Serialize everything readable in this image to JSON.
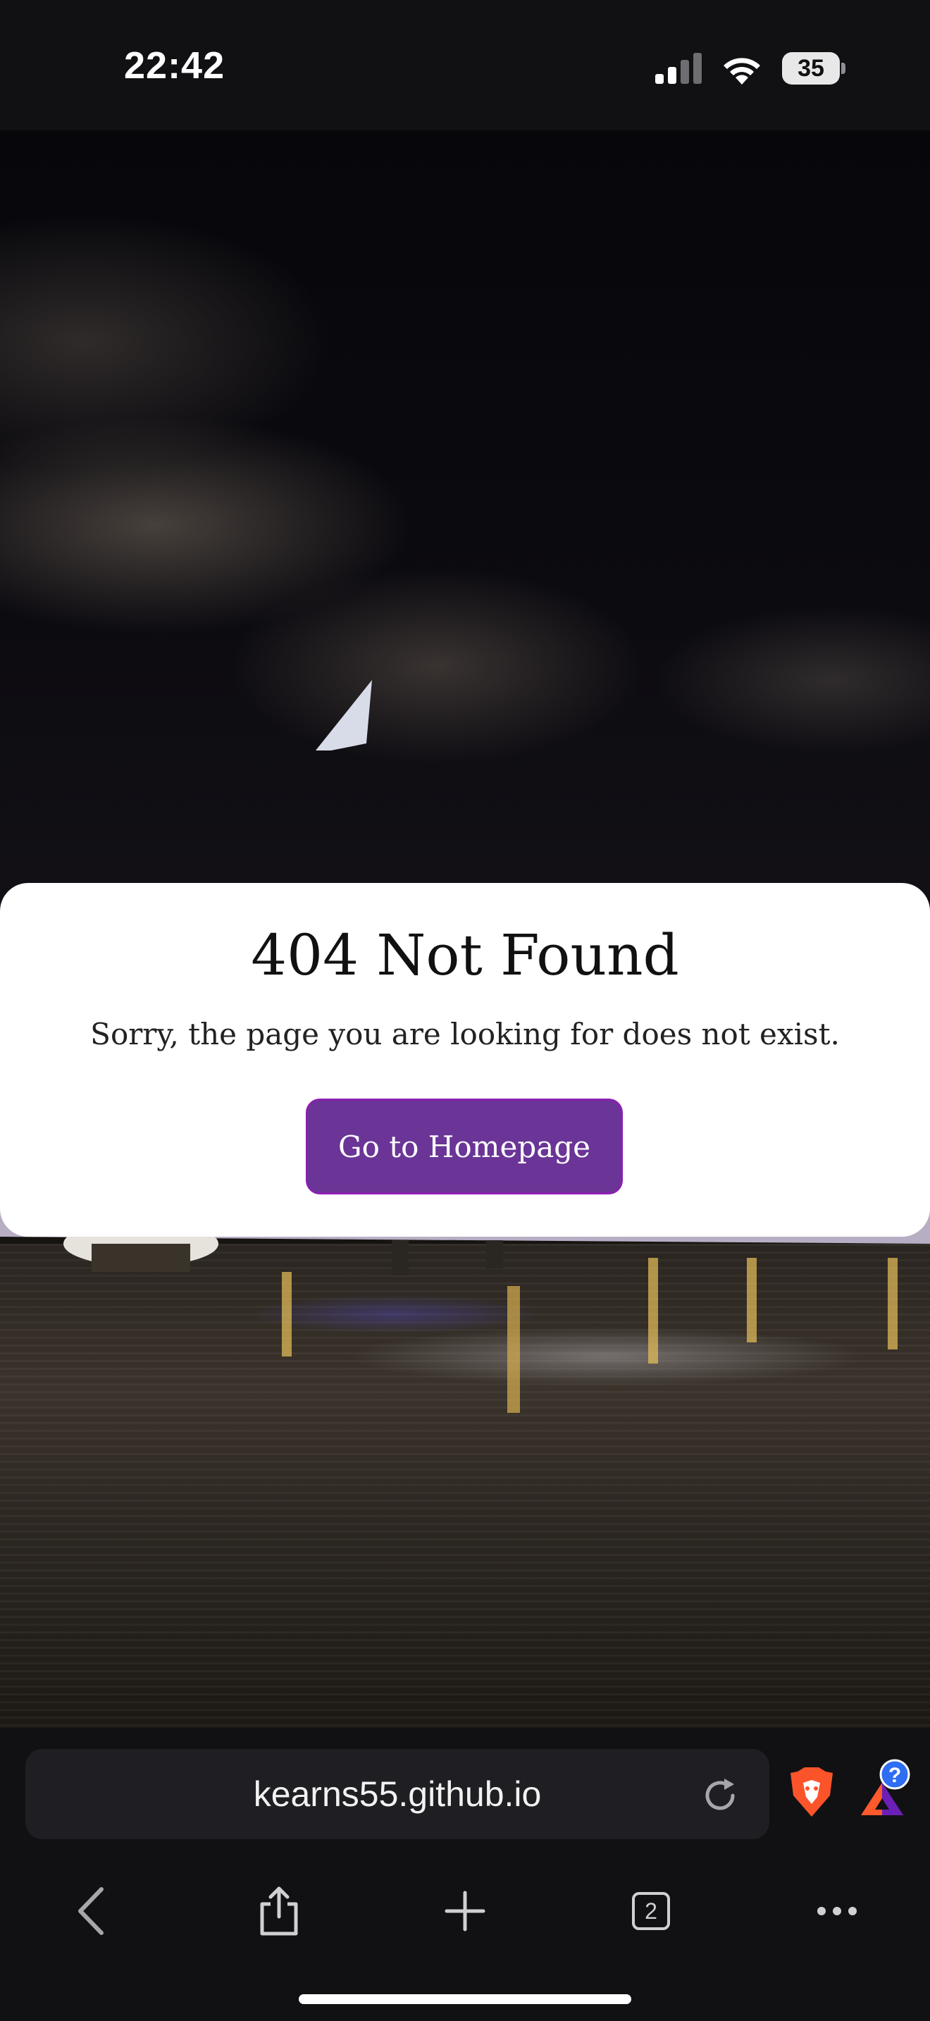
{
  "status_bar": {
    "time": "22:42",
    "battery_level": "35",
    "icons": [
      "cellular-signal-icon",
      "wifi-icon",
      "battery-icon"
    ]
  },
  "page": {
    "title": "404 Not Found",
    "message": "Sorry, the page you are looking for does not exist.",
    "home_button_label": "Go to Homepage",
    "button_color": "#6a3597"
  },
  "browser": {
    "url": "kearns55.github.io",
    "tab_count": "2",
    "rewards_badge": "?",
    "toolbar_icons": [
      "back-icon",
      "share-icon",
      "new-tab-icon",
      "tabs-icon",
      "more-icon"
    ]
  }
}
